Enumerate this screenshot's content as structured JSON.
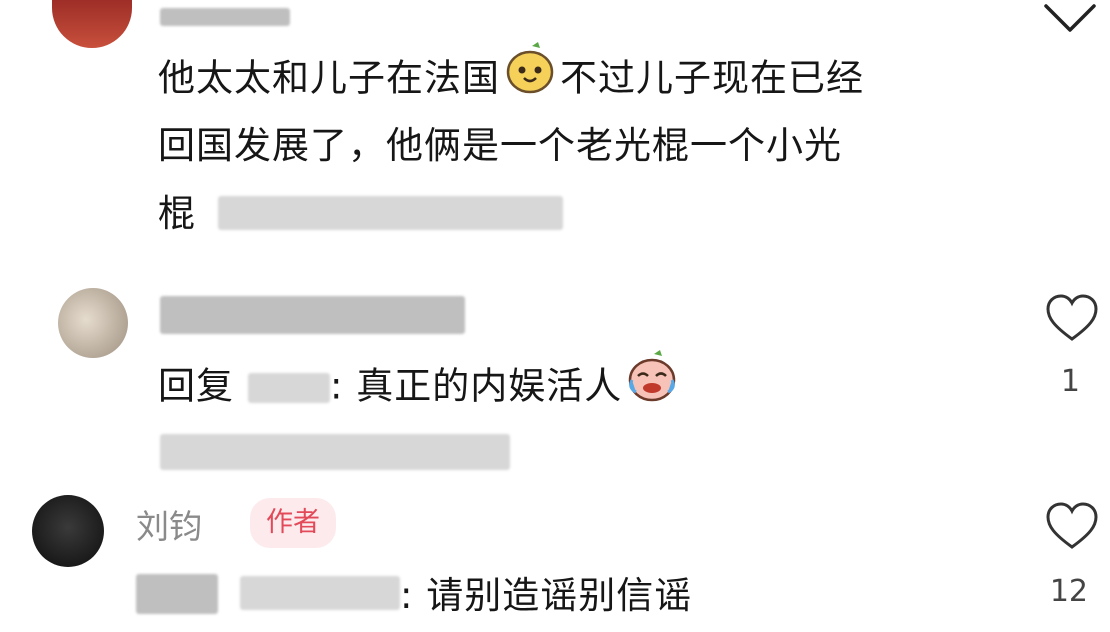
{
  "comments": [
    {
      "user": "",
      "text_lines": [
        "他太太和儿子在法国",
        "不过儿子现在已经",
        "回国发展了，他俩是一个老光棍一个小光",
        "棍"
      ],
      "emoji": "smiling-pear-emoji"
    },
    {
      "user": "",
      "reply_prefix": "回复",
      "reply_suffix": ": 真正的内娱活人",
      "emoji": "crying-laughing-emoji",
      "likes": "1"
    },
    {
      "user": "刘钧",
      "badge": "作者",
      "reply_suffix": ": 请别造谣别信谣",
      "likes": "12"
    }
  ],
  "icons": {
    "chevron": "chevron-down-icon",
    "like": "heart-outline-icon"
  },
  "colors": {
    "badge_bg": "#fdeaec",
    "badge_text": "#e24a5a",
    "username": "#8a8a8a"
  }
}
